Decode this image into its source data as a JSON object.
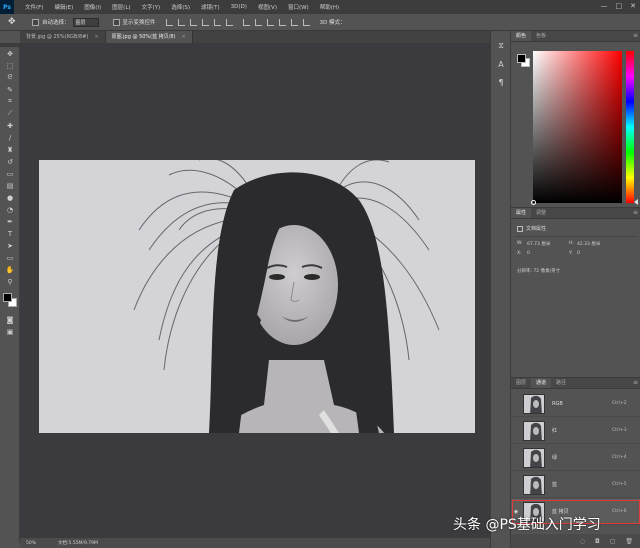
{
  "app": {
    "logo": "Ps"
  },
  "menubar": {
    "items": [
      "文件(F)",
      "编辑(E)",
      "图像(I)",
      "图层(L)",
      "文字(Y)",
      "选择(S)",
      "滤镜(T)",
      "3D(D)",
      "视图(V)",
      "窗口(W)",
      "帮助(H)"
    ],
    "window_controls": [
      "—",
      "□",
      "✕"
    ]
  },
  "options_bar": {
    "auto_select_label": "自动选择：",
    "auto_select_value": "图层",
    "show_transform_label": "显示变换控件",
    "mode_3d_label": "3D 模式："
  },
  "tabs": [
    {
      "label": "背景.jpg @ 25%(RGB/8#)",
      "active": false
    },
    {
      "label": "原图.jpg @ 50%(蓝 拷贝/8)",
      "active": true
    }
  ],
  "status_bar": {
    "zoom": "50%",
    "doc_info": "文档:5.55M/9.79M"
  },
  "color_panel": {
    "tabs": [
      "颜色",
      "色板"
    ],
    "active_tab": 0,
    "foreground": "#000000",
    "background": "#ffffff"
  },
  "properties_panel": {
    "tabs": [
      "属性",
      "调整"
    ],
    "active_tab": 0,
    "doc_label": "文档属性",
    "width_label": "W:",
    "width_value": "67.73 厘米",
    "height_label": "H:",
    "height_value": "42.33 厘米",
    "x_label": "X:",
    "x_value": "0",
    "y_label": "Y:",
    "y_value": "0",
    "resolution": "分辨率: 72 像素/英寸"
  },
  "channels_panel": {
    "tabs": [
      "图层",
      "通道",
      "路径"
    ],
    "active_tab": 1,
    "channels": [
      {
        "name": "RGB",
        "shortcut": "Ctrl+2",
        "visible": false,
        "selected": false
      },
      {
        "name": "红",
        "shortcut": "Ctrl+3",
        "visible": false,
        "selected": false
      },
      {
        "name": "绿",
        "shortcut": "Ctrl+4",
        "visible": false,
        "selected": false
      },
      {
        "name": "蓝",
        "shortcut": "Ctrl+5",
        "visible": false,
        "selected": false
      },
      {
        "name": "蓝 拷贝",
        "shortcut": "Ctrl+6",
        "visible": true,
        "selected": true
      }
    ]
  },
  "watermark": "头条 @PS基础入门学习"
}
